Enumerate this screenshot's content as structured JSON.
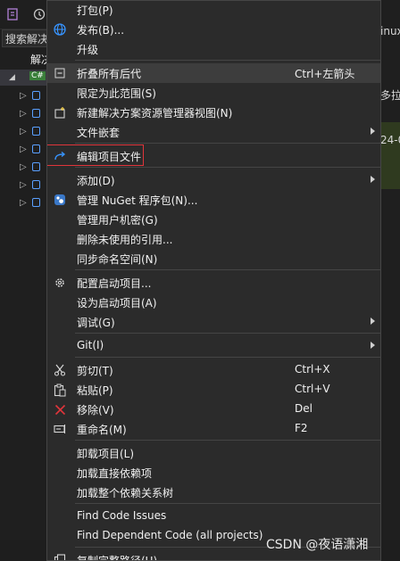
{
  "background": {
    "search_label": "搜索解决",
    "solution_label": "解决",
    "project_badge": "C#",
    "right_text_1": "inux",
    "right_text_2": "多拉",
    "right_text_3": "24-0"
  },
  "menu": {
    "items": [
      {
        "label": "打包(P)"
      },
      {
        "label": "发布(B)...",
        "icon": "globe-icon"
      },
      {
        "label": "升级"
      },
      {
        "label": "折叠所有后代",
        "shortcut": "Ctrl+左箭头",
        "icon": "collapse-icon"
      },
      {
        "label": "限定为此范围(S)"
      },
      {
        "label": "新建解决方案资源管理器视图(N)",
        "icon": "new-view-icon"
      },
      {
        "label": "文件嵌套",
        "submenu": true
      },
      {
        "label": "编辑项目文件",
        "icon": "redo-arrow-icon"
      },
      {
        "label": "添加(D)",
        "submenu": true
      },
      {
        "label": "管理 NuGet 程序包(N)...",
        "icon": "nuget-icon"
      },
      {
        "label": "管理用户机密(G)"
      },
      {
        "label": "删除未使用的引用..."
      },
      {
        "label": "同步命名空间(N)"
      },
      {
        "label": "配置启动项目...",
        "icon": "gear-icon"
      },
      {
        "label": "设为启动项目(A)"
      },
      {
        "label": "调试(G)",
        "submenu": true
      },
      {
        "label": "Git(I)",
        "submenu": true
      },
      {
        "label": "剪切(T)",
        "shortcut": "Ctrl+X",
        "icon": "scissors-icon"
      },
      {
        "label": "粘贴(P)",
        "shortcut": "Ctrl+V",
        "icon": "paste-icon"
      },
      {
        "label": "移除(V)",
        "shortcut": "Del",
        "icon": "remove-x-icon"
      },
      {
        "label": "重命名(M)",
        "shortcut": "F2",
        "icon": "rename-icon"
      },
      {
        "label": "卸载项目(L)"
      },
      {
        "label": "加载直接依赖项"
      },
      {
        "label": "加载整个依赖关系树"
      },
      {
        "label": "Find Code Issues"
      },
      {
        "label": "Find Dependent Code (all projects)"
      },
      {
        "label": "复制完整路径(U)",
        "icon": "copy-icon"
      }
    ]
  },
  "watermark": "CSDN @夜语潇湘",
  "colors": {
    "menu_bg": "#2b2b2b",
    "highlight": "#3d3d3d",
    "annotation_box": "#e0353b",
    "accent_blue": "#3794ff"
  }
}
